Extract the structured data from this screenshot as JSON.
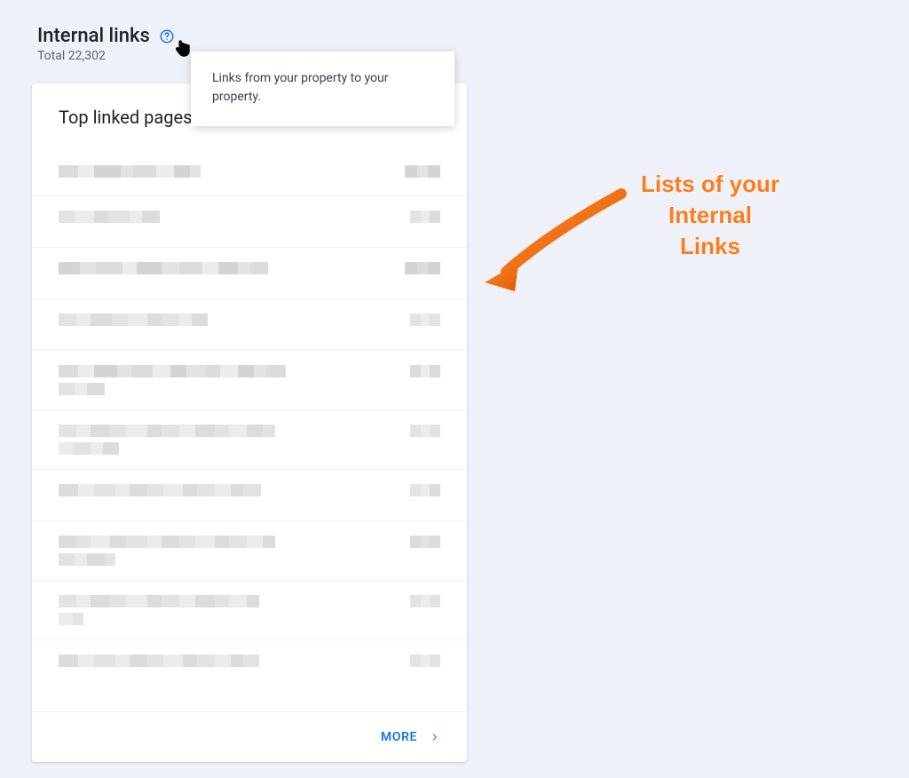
{
  "header": {
    "title": "Internal links",
    "subtitle_prefix": "Total ",
    "total": "22,302"
  },
  "tooltip": {
    "text": "Links from your property to your property."
  },
  "card": {
    "title": "Top linked pages",
    "more_label": "MORE",
    "rows": 10
  },
  "annotation": {
    "line1": "Lists of your",
    "line2": "Internal",
    "line3": "Links"
  },
  "colors": {
    "accent": "#1a73e8",
    "annotation": "#ff7a1a"
  }
}
